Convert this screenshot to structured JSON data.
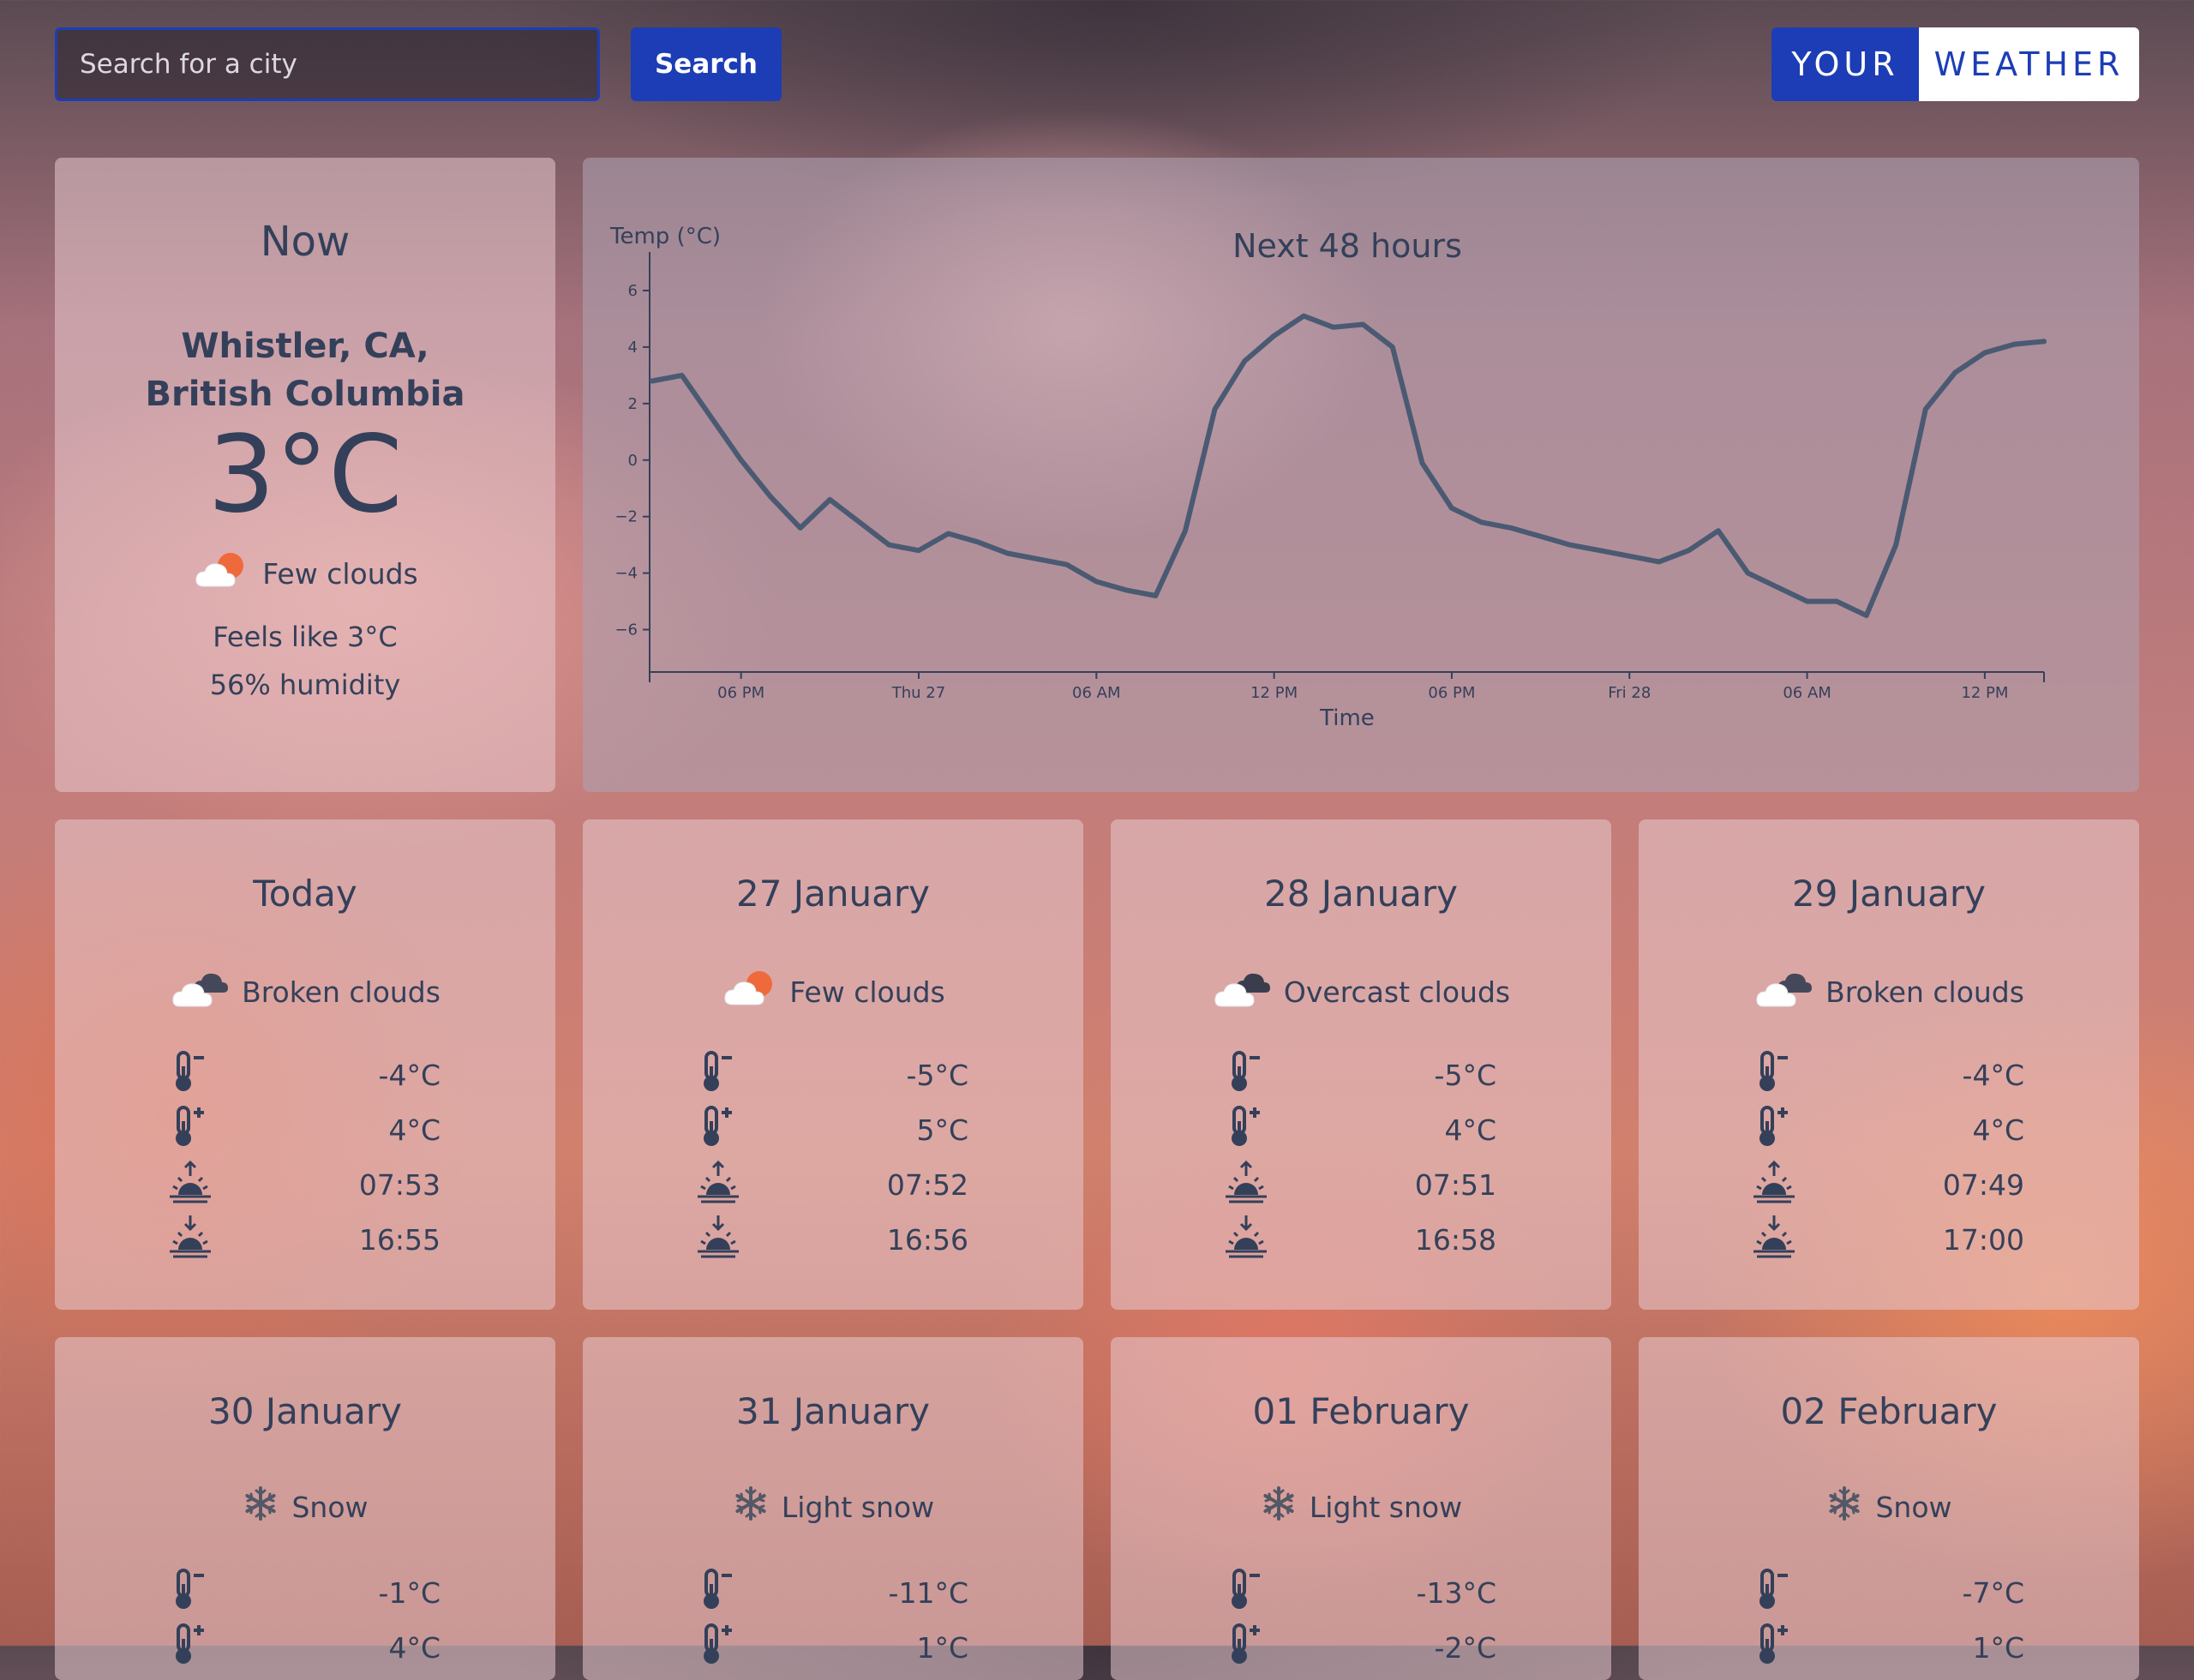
{
  "search": {
    "placeholder": "Search for a city",
    "button_label": "Search"
  },
  "logo": {
    "part1": "YOUR",
    "part2": "WEATHER"
  },
  "now": {
    "title": "Now",
    "city_line1": "Whistler, CA,",
    "city_line2": "British Columbia",
    "temp": "3°C",
    "condition": "Few clouds",
    "condition_icon": "few-clouds-icon",
    "feels_like": "Feels like 3°C",
    "humidity": "56% humidity"
  },
  "chart_data": {
    "type": "line",
    "title": "Next 48 hours",
    "xlabel": "Time",
    "ylabel": "Temp (°C)",
    "ylim": [
      -7.5,
      7
    ],
    "yticks": [
      6,
      4,
      2,
      0,
      -2,
      -4,
      -6
    ],
    "xticks": [
      "06 PM",
      "Thu 27",
      "06 AM",
      "12 PM",
      "06 PM",
      "Fri 28",
      "06 AM",
      "12 PM"
    ],
    "x_start_label": "Wed 26, 03 PM",
    "x_step_hours": 1,
    "series": [
      {
        "values": [
          2.8,
          3.0,
          1.5,
          0.0,
          -1.3,
          -2.4,
          -1.4,
          -2.2,
          -3.0,
          -3.2,
          -2.6,
          -2.9,
          -3.3,
          -3.5,
          -3.7,
          -4.3,
          -4.6,
          -4.8,
          -2.5,
          1.8,
          3.5,
          4.4,
          5.1,
          4.7,
          4.8,
          4.0,
          -0.1,
          -1.7,
          -2.2,
          -2.4,
          -2.7,
          -3.0,
          -3.2,
          -3.4,
          -3.6,
          -3.2,
          -2.5,
          -4.0,
          -4.5,
          -5.0,
          -5.0,
          -5.5,
          -3.0,
          1.8,
          3.1,
          3.8,
          4.1,
          4.2
        ]
      }
    ],
    "line_color": "#4a5a72"
  },
  "days": [
    {
      "title": "Today",
      "condition": "Broken clouds",
      "icon": "broken-clouds-icon",
      "min": "-4°C",
      "max": "4°C",
      "sunrise": "07:53",
      "sunset": "16:55"
    },
    {
      "title": "27 January",
      "condition": "Few clouds",
      "icon": "few-clouds-icon",
      "min": "-5°C",
      "max": "5°C",
      "sunrise": "07:52",
      "sunset": "16:56"
    },
    {
      "title": "28 January",
      "condition": "Overcast clouds",
      "icon": "overcast-clouds-icon",
      "min": "-5°C",
      "max": "4°C",
      "sunrise": "07:51",
      "sunset": "16:58"
    },
    {
      "title": "29 January",
      "condition": "Broken clouds",
      "icon": "broken-clouds-icon",
      "min": "-4°C",
      "max": "4°C",
      "sunrise": "07:49",
      "sunset": "17:00"
    },
    {
      "title": "30 January",
      "condition": "Snow",
      "icon": "snow-icon",
      "min": "-1°C",
      "max": "4°C"
    },
    {
      "title": "31 January",
      "condition": "Light snow",
      "icon": "snow-icon",
      "min": "-11°C",
      "max": "1°C"
    },
    {
      "title": "01 February",
      "condition": "Light snow",
      "icon": "snow-icon",
      "min": "-13°C",
      "max": "-2°C"
    },
    {
      "title": "02 February",
      "condition": "Snow",
      "icon": "snow-icon",
      "min": "-7°C",
      "max": "1°C"
    }
  ],
  "colors": {
    "accent": "#1c3db5",
    "text": "#34405a"
  }
}
